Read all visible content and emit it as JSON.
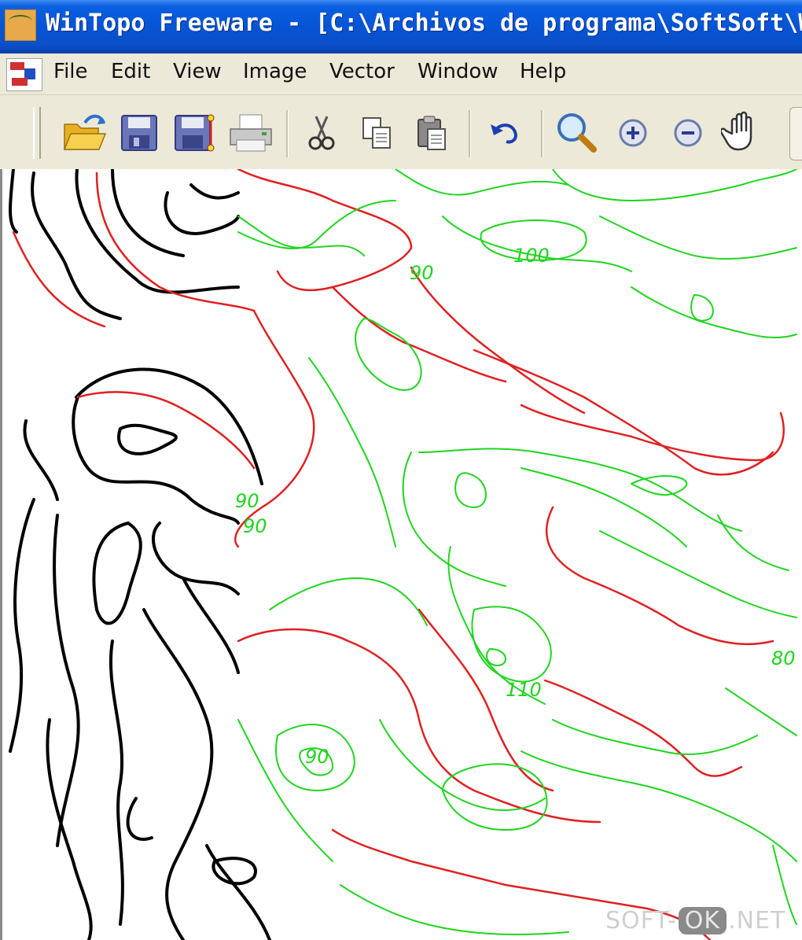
{
  "titlebar": {
    "title": "WinTopo Freeware - [C:\\Archivos de programa\\SoftSoft\\Win"
  },
  "menubar": {
    "items": [
      "File",
      "Edit",
      "View",
      "Image",
      "Vector",
      "Window",
      "Help"
    ]
  },
  "toolbar": {
    "buttons": [
      {
        "icon": "open-folder-icon"
      },
      {
        "icon": "save-icon"
      },
      {
        "icon": "save-vector-icon"
      },
      {
        "icon": "print-icon"
      },
      {
        "icon": "cut-icon"
      },
      {
        "icon": "copy-icon"
      },
      {
        "icon": "paste-icon"
      },
      {
        "icon": "undo-icon"
      },
      {
        "icon": "zoom-icon"
      },
      {
        "icon": "zoom-in-icon"
      },
      {
        "icon": "zoom-out-icon"
      },
      {
        "icon": "pan-hand-icon"
      }
    ]
  },
  "map": {
    "contour_labels": [
      "90",
      "100",
      "90",
      "90",
      "110",
      "90",
      "80"
    ],
    "colors": {
      "black_lines": "#000000",
      "red_contours": "#e02020",
      "green_contours": "#1fd51f"
    }
  },
  "watermark": {
    "left": "SOFT-",
    "ok": "OK",
    "right": ".NET"
  }
}
